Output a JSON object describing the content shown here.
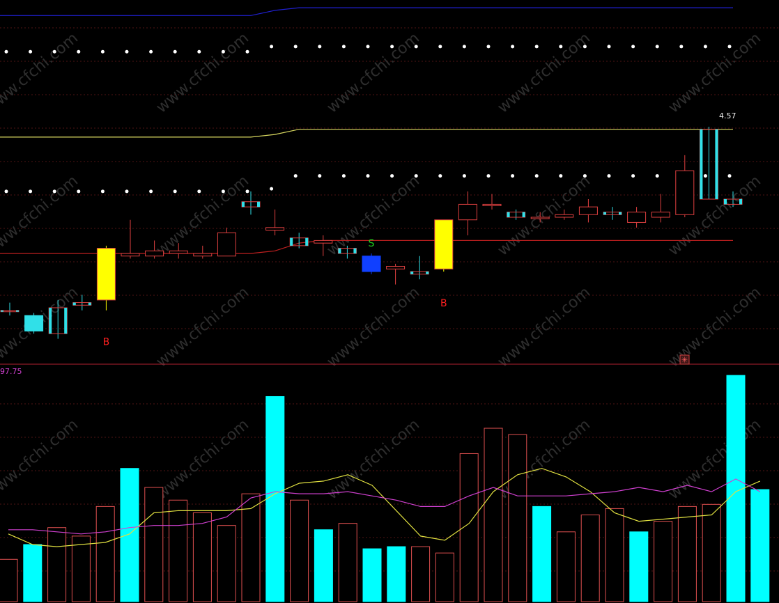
{
  "chart_data": [
    {
      "type": "candlestick",
      "panel": "price",
      "top_label": "",
      "high_marker": "4.57",
      "signals": [
        {
          "index": 4,
          "text": "B",
          "color": "#ff2020"
        },
        {
          "index": 15,
          "text": "S",
          "color": "#20d020"
        },
        {
          "index": 18,
          "text": "B",
          "color": "#ff2020"
        }
      ],
      "icon": "asterisk-icon",
      "candles": [
        {
          "o": 3.6,
          "h": 3.615,
          "l": 3.59,
          "c": 3.6,
          "color": "cyan"
        },
        {
          "o": 3.59,
          "h": 3.595,
          "l": 3.555,
          "c": 3.56,
          "color": "cyan",
          "filled": true
        },
        {
          "o": 3.555,
          "h": 3.62,
          "l": 3.545,
          "c": 3.605,
          "color": "cyan",
          "filled": false
        },
        {
          "o": 3.61,
          "h": 3.63,
          "l": 3.6,
          "c": 3.615,
          "color": "cyan"
        },
        {
          "o": 3.62,
          "h": 3.725,
          "l": 3.6,
          "c": 3.72,
          "color": "yellow",
          "filled": true
        },
        {
          "o": 3.705,
          "h": 3.775,
          "l": 3.7,
          "c": 3.71,
          "color": "red"
        },
        {
          "o": 3.705,
          "h": 3.735,
          "l": 3.7,
          "c": 3.715,
          "color": "red"
        },
        {
          "o": 3.71,
          "h": 3.73,
          "l": 3.7,
          "c": 3.715,
          "color": "red"
        },
        {
          "o": 3.705,
          "h": 3.725,
          "l": 3.7,
          "c": 3.71,
          "color": "red"
        },
        {
          "o": 3.705,
          "h": 3.76,
          "l": 3.705,
          "c": 3.75,
          "color": "red"
        },
        {
          "o": 3.8,
          "h": 3.83,
          "l": 3.785,
          "c": 3.81,
          "color": "cyan",
          "filled": false
        },
        {
          "o": 3.76,
          "h": 3.795,
          "l": 3.745,
          "c": 3.755,
          "color": "red"
        },
        {
          "o": 3.725,
          "h": 3.75,
          "l": 3.72,
          "c": 3.74,
          "color": "cyan",
          "filled": false
        },
        {
          "o": 3.735,
          "h": 3.745,
          "l": 3.705,
          "c": 3.73,
          "color": "red"
        },
        {
          "o": 3.72,
          "h": 3.725,
          "l": 3.7,
          "c": 3.71,
          "color": "cyan",
          "filled": false
        },
        {
          "o": 3.705,
          "h": 3.71,
          "l": 3.67,
          "c": 3.675,
          "color": "blue",
          "filled": true
        },
        {
          "o": 3.68,
          "h": 3.69,
          "l": 3.65,
          "c": 3.685,
          "color": "red"
        },
        {
          "o": 3.67,
          "h": 3.705,
          "l": 3.66,
          "c": 3.675,
          "color": "cyan"
        },
        {
          "o": 3.68,
          "h": 3.775,
          "l": 3.675,
          "c": 3.775,
          "color": "yellow",
          "filled": true
        },
        {
          "o": 3.775,
          "h": 3.83,
          "l": 3.745,
          "c": 3.805,
          "color": "red"
        },
        {
          "o": 3.805,
          "h": 3.825,
          "l": 3.795,
          "c": 3.805,
          "color": "red"
        },
        {
          "o": 3.78,
          "h": 3.795,
          "l": 3.775,
          "c": 3.79,
          "color": "cyan",
          "filled": false
        },
        {
          "o": 3.78,
          "h": 3.79,
          "l": 3.77,
          "c": 3.78,
          "color": "red"
        },
        {
          "o": 3.78,
          "h": 3.795,
          "l": 3.775,
          "c": 3.785,
          "color": "red"
        },
        {
          "o": 3.785,
          "h": 3.815,
          "l": 3.77,
          "c": 3.8,
          "color": "red"
        },
        {
          "o": 3.785,
          "h": 3.8,
          "l": 3.775,
          "c": 3.79,
          "color": "cyan",
          "filled": false
        },
        {
          "o": 3.77,
          "h": 3.8,
          "l": 3.76,
          "c": 3.79,
          "color": "red"
        },
        {
          "o": 3.78,
          "h": 3.825,
          "l": 3.77,
          "c": 3.79,
          "color": "red"
        },
        {
          "o": 3.785,
          "h": 3.9,
          "l": 3.78,
          "c": 3.87,
          "color": "red"
        },
        {
          "o": 3.95,
          "h": 3.955,
          "l": 3.815,
          "c": 3.815,
          "color": "cyan",
          "filled": false
        },
        {
          "o": 3.815,
          "h": 3.83,
          "l": 3.8,
          "c": 3.805,
          "color": "cyan",
          "filled": false
        }
      ],
      "lines": {
        "top_blue": [
          4.17,
          4.17,
          4.17,
          4.17,
          4.17,
          4.17,
          4.17,
          4.17,
          4.17,
          4.17,
          4.17,
          4.18,
          4.185,
          4.185,
          4.185,
          4.185,
          4.185,
          4.185,
          4.185,
          4.185,
          4.185,
          4.185,
          4.185,
          4.185,
          4.185,
          4.185,
          4.185,
          4.185,
          4.185,
          4.185,
          4.185
        ],
        "upper_yellow": [
          3.935,
          3.935,
          3.935,
          3.935,
          3.935,
          3.935,
          3.935,
          3.935,
          3.935,
          3.935,
          3.935,
          3.94,
          3.95,
          3.95,
          3.95,
          3.95,
          3.95,
          3.95,
          3.95,
          3.95,
          3.95,
          3.95,
          3.95,
          3.95,
          3.95,
          3.95,
          3.95,
          3.95,
          3.95,
          3.95,
          3.95
        ],
        "lower_red": [
          3.71,
          3.71,
          3.71,
          3.71,
          3.71,
          3.71,
          3.71,
          3.71,
          3.71,
          3.71,
          3.71,
          3.715,
          3.73,
          3.735,
          3.735,
          3.735,
          3.735,
          3.735,
          3.735,
          3.735,
          3.735,
          3.735,
          3.735,
          3.735,
          3.735,
          3.735,
          3.735,
          3.735,
          3.735,
          3.735,
          3.735
        ],
        "dots_upper": [
          4.1,
          4.1,
          4.1,
          4.1,
          4.1,
          4.1,
          4.1,
          4.1,
          4.1,
          4.1,
          4.1,
          4.11,
          4.11,
          4.11,
          4.11,
          4.11,
          4.11,
          4.11,
          4.11,
          4.11,
          4.11,
          4.11,
          4.11,
          4.11,
          4.11,
          4.11,
          4.11,
          4.11,
          4.11,
          4.11,
          4.11
        ],
        "dots_lower": [
          3.83,
          3.83,
          3.83,
          3.83,
          3.83,
          3.83,
          3.83,
          3.83,
          3.83,
          3.83,
          3.83,
          3.835,
          3.86,
          3.86,
          3.86,
          3.86,
          3.86,
          3.86,
          3.86,
          3.86,
          3.86,
          3.86,
          3.86,
          3.86,
          3.86,
          3.86,
          3.86,
          3.86,
          3.86,
          3.86,
          3.86
        ]
      }
    },
    {
      "type": "bar",
      "panel": "volume",
      "label": "97.75",
      "values": [
        20,
        27,
        35,
        31,
        45,
        63,
        54,
        48,
        42,
        36,
        51,
        97,
        48,
        34,
        37,
        25,
        26,
        26,
        23,
        70,
        82,
        79,
        45,
        33,
        41,
        44,
        33,
        38,
        45,
        46,
        107,
        53
      ],
      "up": [
        false,
        true,
        false,
        false,
        false,
        true,
        false,
        false,
        false,
        false,
        false,
        true,
        false,
        true,
        false,
        true,
        true,
        false,
        false,
        false,
        false,
        false,
        true,
        false,
        false,
        false,
        true,
        false,
        false,
        false,
        true,
        true
      ],
      "ma_yellow": [
        32,
        27,
        26,
        27,
        28,
        32,
        42,
        43,
        43,
        43,
        44,
        51,
        56,
        57,
        60,
        55,
        43,
        31,
        29,
        37,
        52,
        60,
        63,
        59,
        52,
        42,
        38,
        39,
        40,
        41,
        52,
        57
      ],
      "ma_magenta": [
        34,
        34,
        33,
        32,
        33,
        35,
        36,
        36,
        37,
        40,
        49,
        52,
        51,
        51,
        52,
        50,
        48,
        45,
        45,
        50,
        54,
        50,
        50,
        50,
        51,
        52,
        54,
        52,
        55,
        52,
        58,
        52
      ]
    }
  ],
  "watermark": "www.cfchi.com"
}
